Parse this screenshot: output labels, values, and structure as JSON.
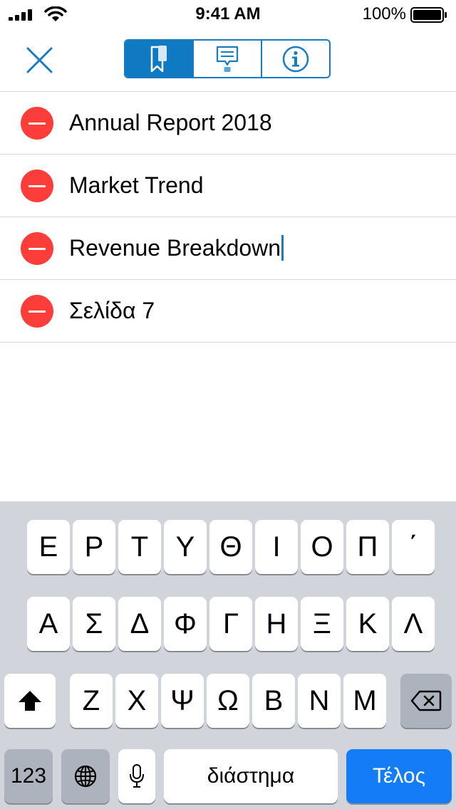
{
  "status_bar": {
    "time": "9:41 AM",
    "battery": "100%"
  },
  "toolbar": {
    "close_icon": "close-x-icon",
    "segments": [
      {
        "icon": "bookmark-icon",
        "active": true
      },
      {
        "icon": "comment-icon",
        "active": false
      },
      {
        "icon": "info-icon",
        "active": false
      }
    ],
    "accent_color": "#0f7ac2"
  },
  "bookmarks": [
    {
      "title": "Annual Report 2018"
    },
    {
      "title": "Market Trend"
    },
    {
      "title": "Revenue Breakdown",
      "editing": true
    },
    {
      "title": "Σελίδα 7"
    }
  ],
  "delete_color": "#fc3d39",
  "keyboard": {
    "row1": [
      "Ε",
      "Ρ",
      "Τ",
      "Υ",
      "Θ",
      "Ι",
      "Ο",
      "Π",
      "΄"
    ],
    "row2": [
      "Α",
      "Σ",
      "Δ",
      "Φ",
      "Γ",
      "Η",
      "Ξ",
      "Κ",
      "Λ"
    ],
    "row3": [
      "Ζ",
      "Χ",
      "Ψ",
      "Ω",
      "Β",
      "Ν",
      "Μ"
    ],
    "numbers_label": "123",
    "space_label": "διάστημα",
    "done_label": "Τέλος",
    "done_color": "#137cf6"
  }
}
